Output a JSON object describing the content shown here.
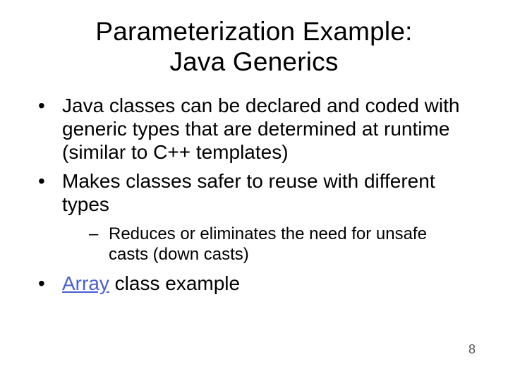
{
  "title_line1": "Parameterization Example:",
  "title_line2": "Java Generics",
  "bullets": {
    "b1": "Java classes can be declared and coded with generic types that are determined at runtime (similar to C++ templates)",
    "b2": "Makes classes safer to reuse with different types",
    "b2_sub1": "Reduces or eliminates the need for unsafe casts (down casts)",
    "b3_link": "Array",
    "b3_rest": " class example"
  },
  "page_number": "8"
}
